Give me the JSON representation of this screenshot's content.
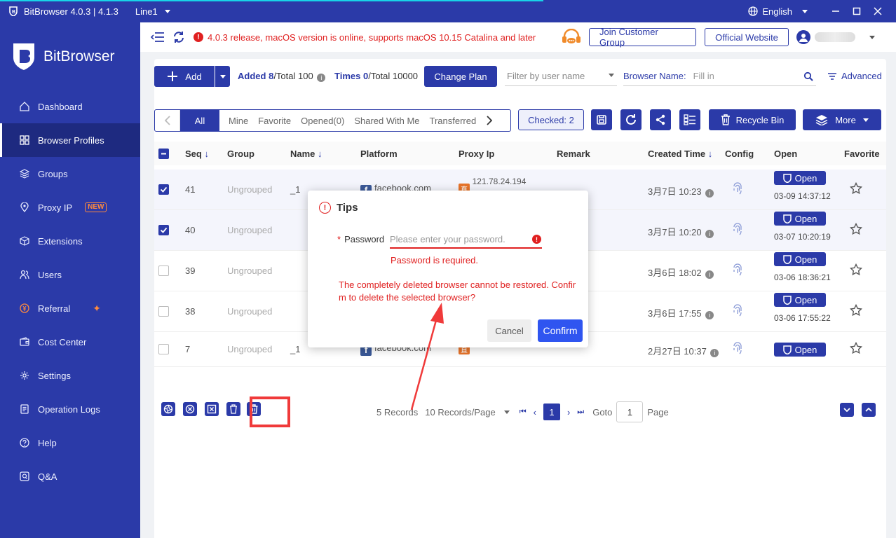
{
  "titlebar": {
    "app_title": "BitBrowser 4.0.3 | 4.1.3",
    "line": "Line1",
    "language": "English"
  },
  "sidebar": {
    "logo": "BitBrowser",
    "items": [
      {
        "label": "Dashboard",
        "icon": "home-icon"
      },
      {
        "label": "Browser Profiles",
        "icon": "grid-icon"
      },
      {
        "label": "Groups",
        "icon": "layers-icon"
      },
      {
        "label": "Proxy IP",
        "icon": "location-icon",
        "badge": "NEW"
      },
      {
        "label": "Extensions",
        "icon": "cube-icon"
      },
      {
        "label": "Users",
        "icon": "users-icon"
      },
      {
        "label": "Referral",
        "icon": "coin-icon"
      },
      {
        "label": "Cost Center",
        "icon": "wallet-icon"
      },
      {
        "label": "Settings",
        "icon": "gear-icon"
      },
      {
        "label": "Operation Logs",
        "icon": "log-icon"
      },
      {
        "label": "Help",
        "icon": "help-icon"
      },
      {
        "label": "Q&A",
        "icon": "qa-icon"
      }
    ]
  },
  "topbar": {
    "notice": "4.0.3 release, macOS version is online, supports macOS 10.15 Catalina and later",
    "join_group": "Join Customer Group",
    "official_site": "Official Website"
  },
  "toolbar": {
    "add": "Add",
    "added_label": "Added",
    "added_count": "8",
    "added_total": "/Total 100",
    "times_label": "Times",
    "times_count": "0",
    "times_total": "/Total 10000",
    "change_plan": "Change Plan",
    "filter_placeholder": "Filter by user name",
    "browser_name_label": "Browser Name:",
    "browser_name_placeholder": "Fill in",
    "advanced": "Advanced"
  },
  "tabs": [
    "All",
    "Mine",
    "Favorite",
    "Opened(0)",
    "Shared With Me",
    "Transferred"
  ],
  "actions": {
    "checked": "Checked: 2",
    "recycle_bin": "Recycle Bin",
    "more": "More"
  },
  "table": {
    "headers": {
      "seq": "Seq",
      "group": "Group",
      "name": "Name",
      "platform": "Platform",
      "proxy_ip": "Proxy Ip",
      "remark": "Remark",
      "created_time": "Created Time",
      "config": "Config",
      "open": "Open",
      "favorite": "Favorite"
    },
    "rows": [
      {
        "seq": "41",
        "group": "Ungrouped",
        "name": "_1",
        "platform": "facebook.com",
        "proxy": "121.78.24.194",
        "created": "3月7日 10:23",
        "open": "Open",
        "opened_at": "03-09 14:37:12",
        "checked": true
      },
      {
        "seq": "40",
        "group": "Ungrouped",
        "name": "",
        "platform": "",
        "proxy": "",
        "created": "3月7日 10:20",
        "open": "Open",
        "opened_at": "03-07 10:20:19",
        "checked": true
      },
      {
        "seq": "39",
        "group": "Ungrouped",
        "name": "",
        "platform": "",
        "proxy": "",
        "created": "3月6日 18:02",
        "open": "Open",
        "opened_at": "03-06 18:36:21",
        "checked": false
      },
      {
        "seq": "38",
        "group": "Ungrouped",
        "name": "",
        "platform": "",
        "proxy": "",
        "created": "3月6日 17:55",
        "open": "Open",
        "opened_at": "03-06 17:55:22",
        "checked": false
      },
      {
        "seq": "7",
        "group": "Ungrouped",
        "name": "_1",
        "platform": "facebook.com",
        "proxy": "",
        "created": "2月27日 10:37",
        "open": "Open",
        "opened_at": "",
        "checked": false
      }
    ]
  },
  "pager": {
    "records": "5 Records",
    "per_page": "10 Records/Page",
    "current": "1",
    "goto_label": "Goto",
    "goto_value": "1",
    "page_label": "Page"
  },
  "modal": {
    "title": "Tips",
    "password_label": "Password",
    "password_placeholder": "Please enter your password.",
    "password_error": "Password is required.",
    "warning": "The completely deleted browser cannot be restored. Confirm to delete the selected browser?",
    "cancel": "Cancel",
    "confirm": "Confirm"
  },
  "colors": {
    "brand": "#2b3aa8",
    "error": "#e02020",
    "confirm": "#2f55f0",
    "annotation": "#f03a3a"
  }
}
